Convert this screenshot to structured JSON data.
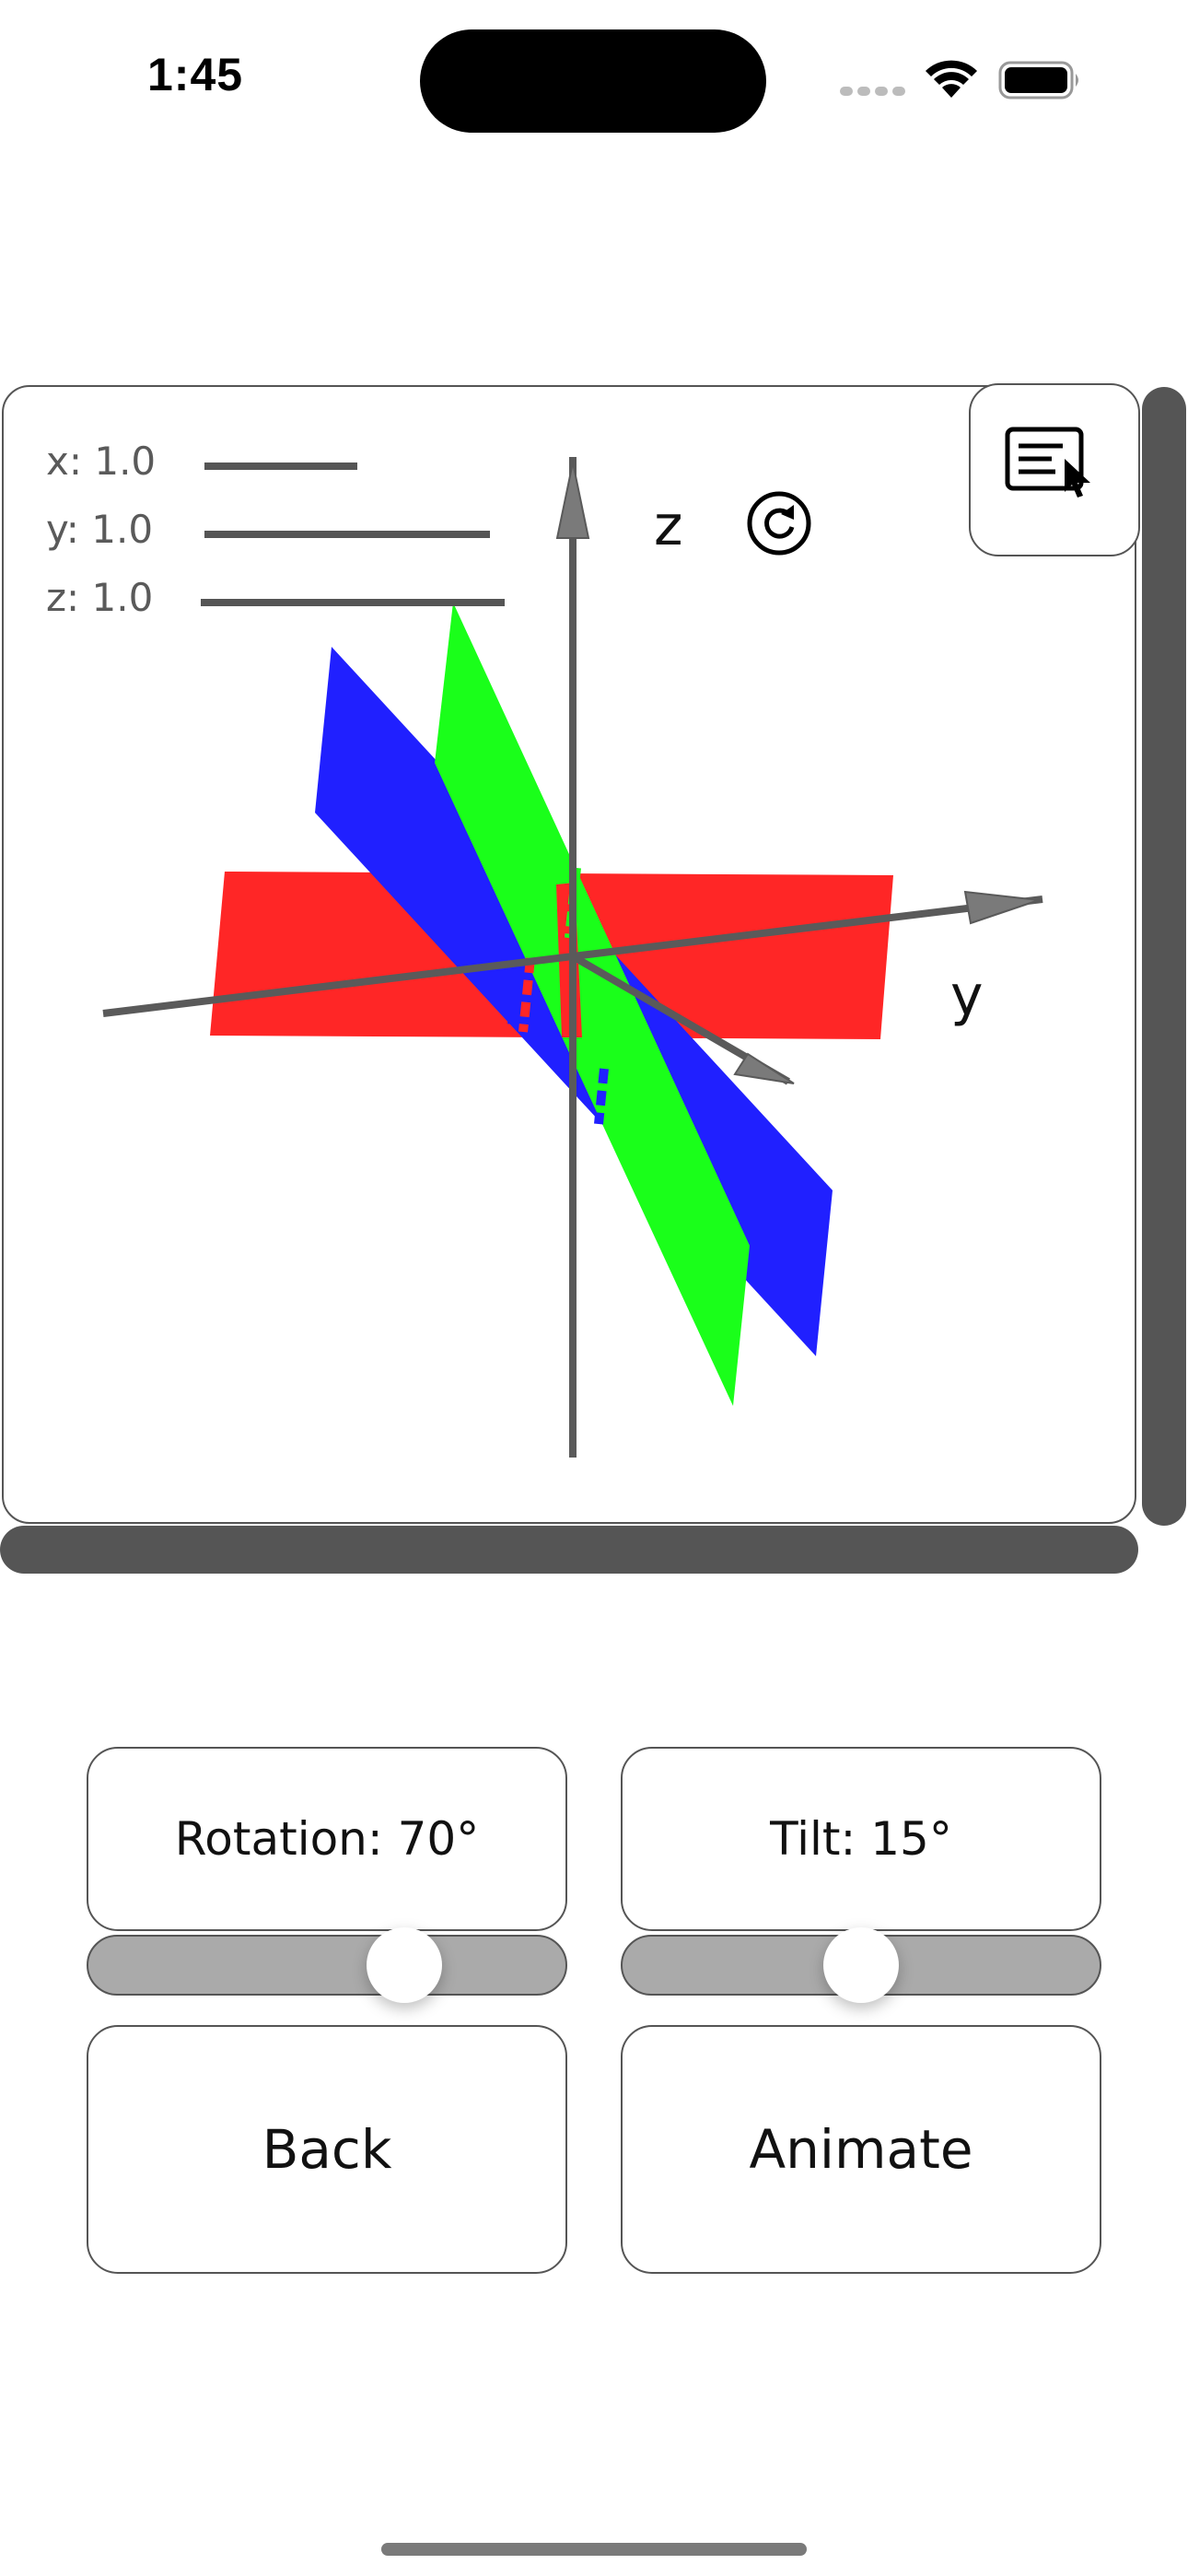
{
  "status_bar": {
    "time": "1:45"
  },
  "view": {
    "scale": {
      "x_label": "x: 1.0",
      "y_label": "y: 1.0",
      "z_label": "z: 1.0",
      "x": 1.0,
      "y": 1.0,
      "z": 1.0
    },
    "axis_labels": {
      "z": "z",
      "y": "y"
    },
    "plane_colors": {
      "red": "#ff2626",
      "green": "#1aff1a",
      "blue": "#2020ff"
    },
    "axis_color": "#5a5a5a",
    "icons": {
      "reset": "rotate-reset-icon",
      "menu": "menu-pointer-icon"
    }
  },
  "controls": {
    "rotation": {
      "label": "Rotation: 70°",
      "value_deg": 70,
      "fraction": 0.54
    },
    "tilt": {
      "label": "Tilt: 15°",
      "value_deg": 15,
      "fraction": 0.5
    },
    "back_label": "Back",
    "animate_label": "Animate"
  }
}
